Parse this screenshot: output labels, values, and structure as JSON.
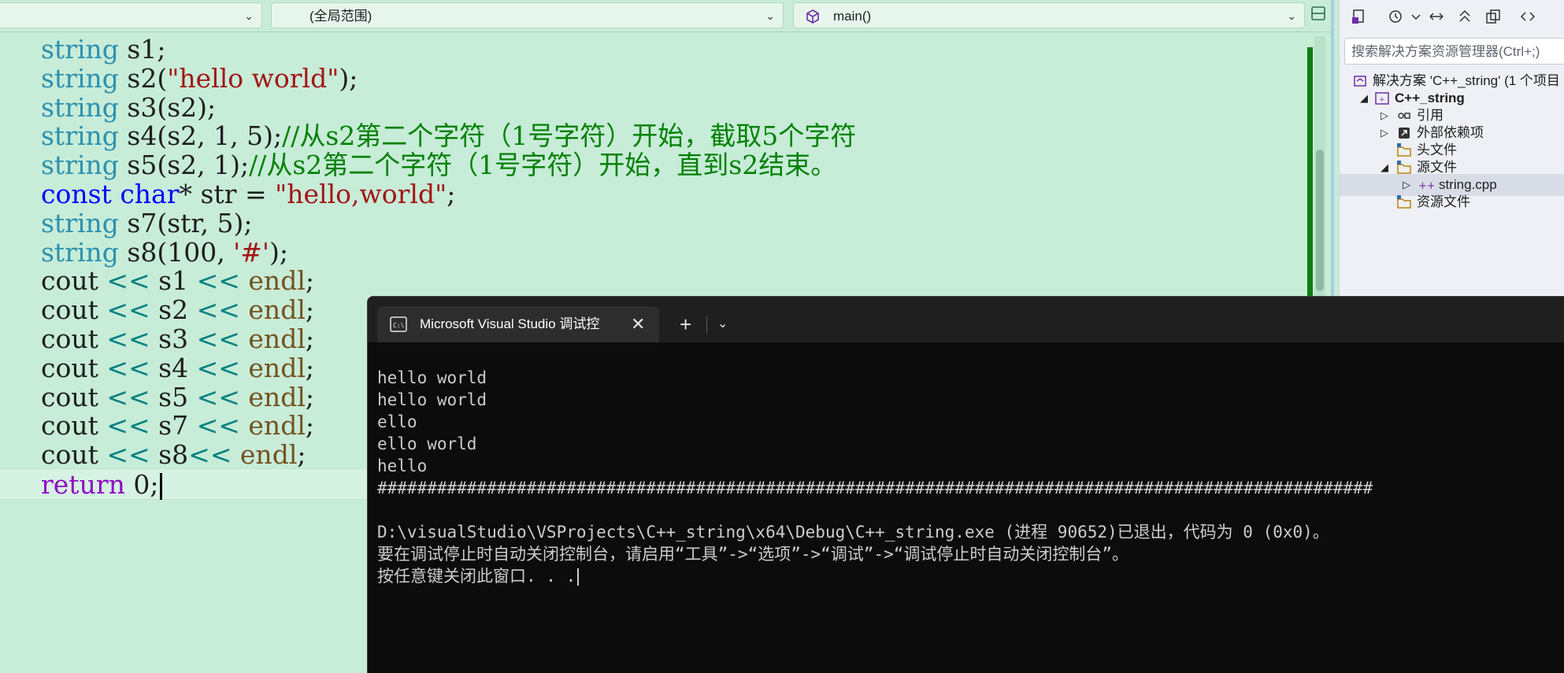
{
  "navbar": {
    "file_combo": "",
    "scope_combo": "(全局范围)",
    "function_combo": "main()"
  },
  "code": {
    "lines": [
      [
        {
          "t": "type",
          "s": "string"
        },
        {
          "t": "plain",
          "s": " s1;"
        }
      ],
      [
        {
          "t": "type",
          "s": "string"
        },
        {
          "t": "plain",
          "s": " s2("
        },
        {
          "t": "str",
          "s": "\"hello world\""
        },
        {
          "t": "plain",
          "s": ");"
        }
      ],
      [
        {
          "t": "type",
          "s": "string"
        },
        {
          "t": "plain",
          "s": " s3(s2);"
        }
      ],
      [
        {
          "t": "type",
          "s": "string"
        },
        {
          "t": "plain",
          "s": " s4(s2, 1, 5);"
        },
        {
          "t": "cmt",
          "s": "//从s2第二个字符（1号字符）开始，截取5个字符"
        }
      ],
      [
        {
          "t": "type",
          "s": "string"
        },
        {
          "t": "plain",
          "s": " s5(s2, 1);"
        },
        {
          "t": "cmt",
          "s": "//从s2第二个字符（1号字符）开始，直到s2结束。"
        }
      ],
      [
        {
          "t": "kw",
          "s": "const"
        },
        {
          "t": "plain",
          "s": " "
        },
        {
          "t": "kw",
          "s": "char"
        },
        {
          "t": "plain",
          "s": "* str = "
        },
        {
          "t": "str",
          "s": "\"hello,world\""
        },
        {
          "t": "plain",
          "s": ";"
        }
      ],
      [
        {
          "t": "type",
          "s": "string"
        },
        {
          "t": "plain",
          "s": " s7(str, 5);"
        }
      ],
      [
        {
          "t": "type",
          "s": "string"
        },
        {
          "t": "plain",
          "s": " s8(100, "
        },
        {
          "t": "str",
          "s": "'#'"
        },
        {
          "t": "plain",
          "s": ");"
        }
      ],
      [
        {
          "t": "plain",
          "s": "cout "
        },
        {
          "t": "op",
          "s": "<<"
        },
        {
          "t": "plain",
          "s": " s1 "
        },
        {
          "t": "op",
          "s": "<<"
        },
        {
          "t": "plain",
          "s": " "
        },
        {
          "t": "endl",
          "s": "endl"
        },
        {
          "t": "plain",
          "s": ";"
        }
      ],
      [
        {
          "t": "plain",
          "s": "cout "
        },
        {
          "t": "op",
          "s": "<<"
        },
        {
          "t": "plain",
          "s": " s2 "
        },
        {
          "t": "op",
          "s": "<<"
        },
        {
          "t": "plain",
          "s": " "
        },
        {
          "t": "endl",
          "s": "endl"
        },
        {
          "t": "plain",
          "s": ";"
        }
      ],
      [
        {
          "t": "plain",
          "s": "cout "
        },
        {
          "t": "op",
          "s": "<<"
        },
        {
          "t": "plain",
          "s": " s3 "
        },
        {
          "t": "op",
          "s": "<<"
        },
        {
          "t": "plain",
          "s": " "
        },
        {
          "t": "endl",
          "s": "endl"
        },
        {
          "t": "plain",
          "s": ";"
        }
      ],
      [
        {
          "t": "plain",
          "s": "cout "
        },
        {
          "t": "op",
          "s": "<<"
        },
        {
          "t": "plain",
          "s": " s4 "
        },
        {
          "t": "op",
          "s": "<<"
        },
        {
          "t": "plain",
          "s": " "
        },
        {
          "t": "endl",
          "s": "endl"
        },
        {
          "t": "plain",
          "s": ";"
        }
      ],
      [
        {
          "t": "plain",
          "s": "cout "
        },
        {
          "t": "op",
          "s": "<<"
        },
        {
          "t": "plain",
          "s": " s5 "
        },
        {
          "t": "op",
          "s": "<<"
        },
        {
          "t": "plain",
          "s": " "
        },
        {
          "t": "endl",
          "s": "endl"
        },
        {
          "t": "plain",
          "s": ";"
        }
      ],
      [
        {
          "t": "plain",
          "s": "cout "
        },
        {
          "t": "op",
          "s": "<<"
        },
        {
          "t": "plain",
          "s": " s7 "
        },
        {
          "t": "op",
          "s": "<<"
        },
        {
          "t": "plain",
          "s": " "
        },
        {
          "t": "endl",
          "s": "endl"
        },
        {
          "t": "plain",
          "s": ";"
        }
      ],
      [
        {
          "t": "plain",
          "s": "cout "
        },
        {
          "t": "op",
          "s": "<<"
        },
        {
          "t": "plain",
          "s": " s8"
        },
        {
          "t": "op",
          "s": "<<"
        },
        {
          "t": "plain",
          "s": " "
        },
        {
          "t": "endl",
          "s": "endl"
        },
        {
          "t": "plain",
          "s": ";"
        }
      ],
      [
        {
          "t": "ret",
          "s": "return"
        },
        {
          "t": "plain",
          "s": " 0;"
        }
      ]
    ]
  },
  "solution_explorer": {
    "search_placeholder": "搜索解决方案资源管理器(Ctrl+;)",
    "items": [
      {
        "label": "解决方案 'C++_string' (1 个项目",
        "icon": "solution-icon"
      },
      {
        "label": "C++_string",
        "icon": "project-icon"
      },
      {
        "label": "引用",
        "icon": "references-icon"
      },
      {
        "label": "外部依赖项",
        "icon": "external-deps-icon"
      },
      {
        "label": "头文件",
        "icon": "folder-icon"
      },
      {
        "label": "源文件",
        "icon": "folder-icon"
      },
      {
        "label": "string.cpp",
        "icon": "cpp-file-icon"
      },
      {
        "label": "资源文件",
        "icon": "folder-icon"
      }
    ]
  },
  "console": {
    "tab_title": "Microsoft Visual Studio 调试控",
    "close_glyph": "✕",
    "plus_glyph": "+",
    "dropdown_glyph": "⌄",
    "output": [
      "",
      "hello world",
      "hello world",
      "ello",
      "ello world",
      "hello",
      "####################################################################################################",
      "",
      "D:\\visualStudio\\VSProjects\\C++_string\\x64\\Debug\\C++_string.exe (进程 90652)已退出，代码为 0 (0x0)。",
      "要在调试停止时自动关闭控制台，请启用“工具”->“选项”->“调试”->“调试停止时自动关闭控制台”。",
      "按任意键关闭此窗口. . ."
    ]
  },
  "colors": {
    "editor_bg": "#c7ecd8",
    "type": "#2b91af",
    "keyword": "#0000ff",
    "return_kw": "#8f08c4",
    "string": "#a31515",
    "comment": "#008000",
    "console_bg": "#0c0c0c"
  }
}
